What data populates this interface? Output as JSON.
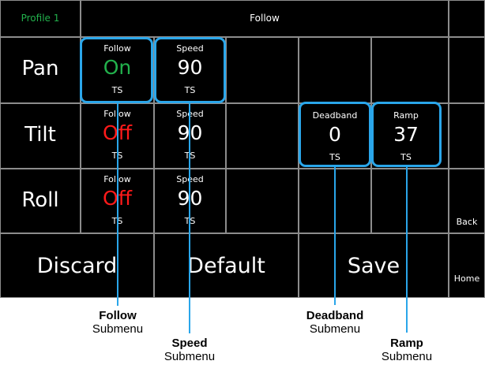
{
  "header": {
    "profile": "Profile 1",
    "title": "Follow"
  },
  "colors": {
    "on": "#22b14c",
    "off": "#ff1a1a",
    "profile": "#22b14c",
    "highlight": "#2aa6ea"
  },
  "side_buttons": {
    "back": "Back",
    "home": "Home"
  },
  "rows": [
    {
      "axis": "Pan",
      "follow": {
        "label": "Follow",
        "value": "On",
        "sub": "TS"
      },
      "speed": {
        "label": "Speed",
        "value": "90",
        "sub": "TS"
      }
    },
    {
      "axis": "Tilt",
      "follow": {
        "label": "Follow",
        "value": "Off",
        "sub": "TS"
      },
      "speed": {
        "label": "Speed",
        "value": "90",
        "sub": "TS"
      },
      "deadband": {
        "label": "Deadband",
        "value": "0",
        "sub": "TS"
      },
      "ramp": {
        "label": "Ramp",
        "value": "37",
        "sub": "TS"
      }
    },
    {
      "axis": "Roll",
      "follow": {
        "label": "Follow",
        "value": "Off",
        "sub": "TS"
      },
      "speed": {
        "label": "Speed",
        "value": "90",
        "sub": "TS"
      }
    }
  ],
  "bottom": {
    "discard": "Discard",
    "default": "Default",
    "save": "Save"
  },
  "annotations": {
    "follow": {
      "title": "Follow",
      "sub": "Submenu"
    },
    "speed": {
      "title": "Speed",
      "sub": "Submenu"
    },
    "deadband": {
      "title": "Deadband",
      "sub": "Submenu"
    },
    "ramp": {
      "title": "Ramp",
      "sub": "Submenu"
    }
  }
}
